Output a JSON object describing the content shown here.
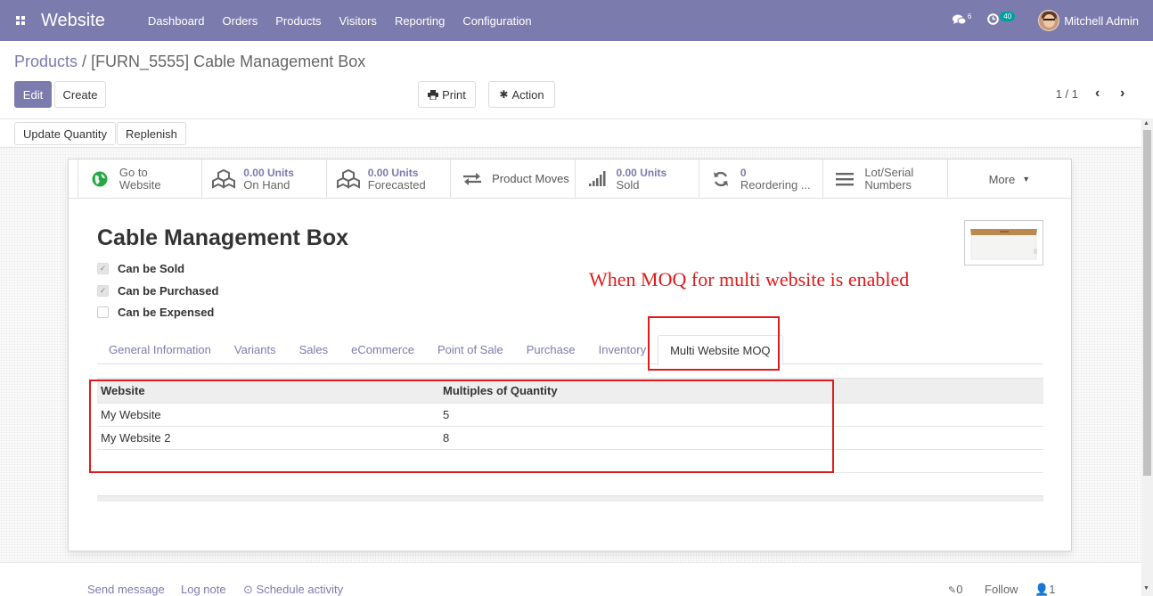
{
  "navbar": {
    "brand": "Website",
    "menu": [
      "Dashboard",
      "Orders",
      "Products",
      "Visitors",
      "Reporting",
      "Configuration"
    ],
    "messages_count": "6",
    "activities_count": "40",
    "user_name": "Mitchell Admin",
    "bg_color": "#7c7bad"
  },
  "breadcrumb": {
    "parent": "Products",
    "separator": " / ",
    "current": "[FURN_5555] Cable Management Box"
  },
  "buttons": {
    "edit": "Edit",
    "create": "Create",
    "print": "Print",
    "action": "Action"
  },
  "pager": {
    "value": "1 / 1"
  },
  "statusbar": {
    "update_quantity": "Update Quantity",
    "replenish": "Replenish"
  },
  "smart_buttons": [
    {
      "line1": "Go to",
      "line2": "Website",
      "icon": "globe-icon"
    },
    {
      "value": "0.00 Units",
      "label": "On Hand",
      "icon": "cubes-icon"
    },
    {
      "value": "0.00 Units",
      "label": "Forecasted",
      "icon": "cubes-icon"
    },
    {
      "label": "Product Moves",
      "icon": "exchange-icon"
    },
    {
      "value": "0.00 Units",
      "label": "Sold",
      "icon": "signal-icon"
    },
    {
      "value": "0",
      "label": "Reordering ...",
      "icon": "refresh-icon"
    },
    {
      "line1": "Lot/Serial",
      "line2": "Numbers",
      "icon": "bars-icon"
    }
  ],
  "more_label": "More",
  "product": {
    "name": "Cable Management Box",
    "can_be_sold": "Can be Sold",
    "can_be_purchased": "Can be Purchased",
    "can_be_expensed": "Can be Expensed",
    "sold_checked": true,
    "purchased_checked": true,
    "expensed_checked": false
  },
  "annotation": "When MOQ for multi website is enabled",
  "annotation_color": "#e01b1b",
  "tabs": [
    "General Information",
    "Variants",
    "Sales",
    "eCommerce",
    "Point of Sale",
    "Purchase",
    "Inventory",
    "Multi Website MOQ"
  ],
  "active_tab": "Multi Website MOQ",
  "moq_table": {
    "headers": [
      "Website",
      "Multiples of Quantity"
    ],
    "rows": [
      [
        "My Website",
        "5"
      ],
      [
        "My Website 2",
        "8"
      ]
    ]
  },
  "chatter": {
    "send_message": "Send message",
    "log_note": "Log note",
    "schedule_activity": "Schedule activity",
    "attachments": "0",
    "follow": "Follow",
    "followers": "1"
  }
}
